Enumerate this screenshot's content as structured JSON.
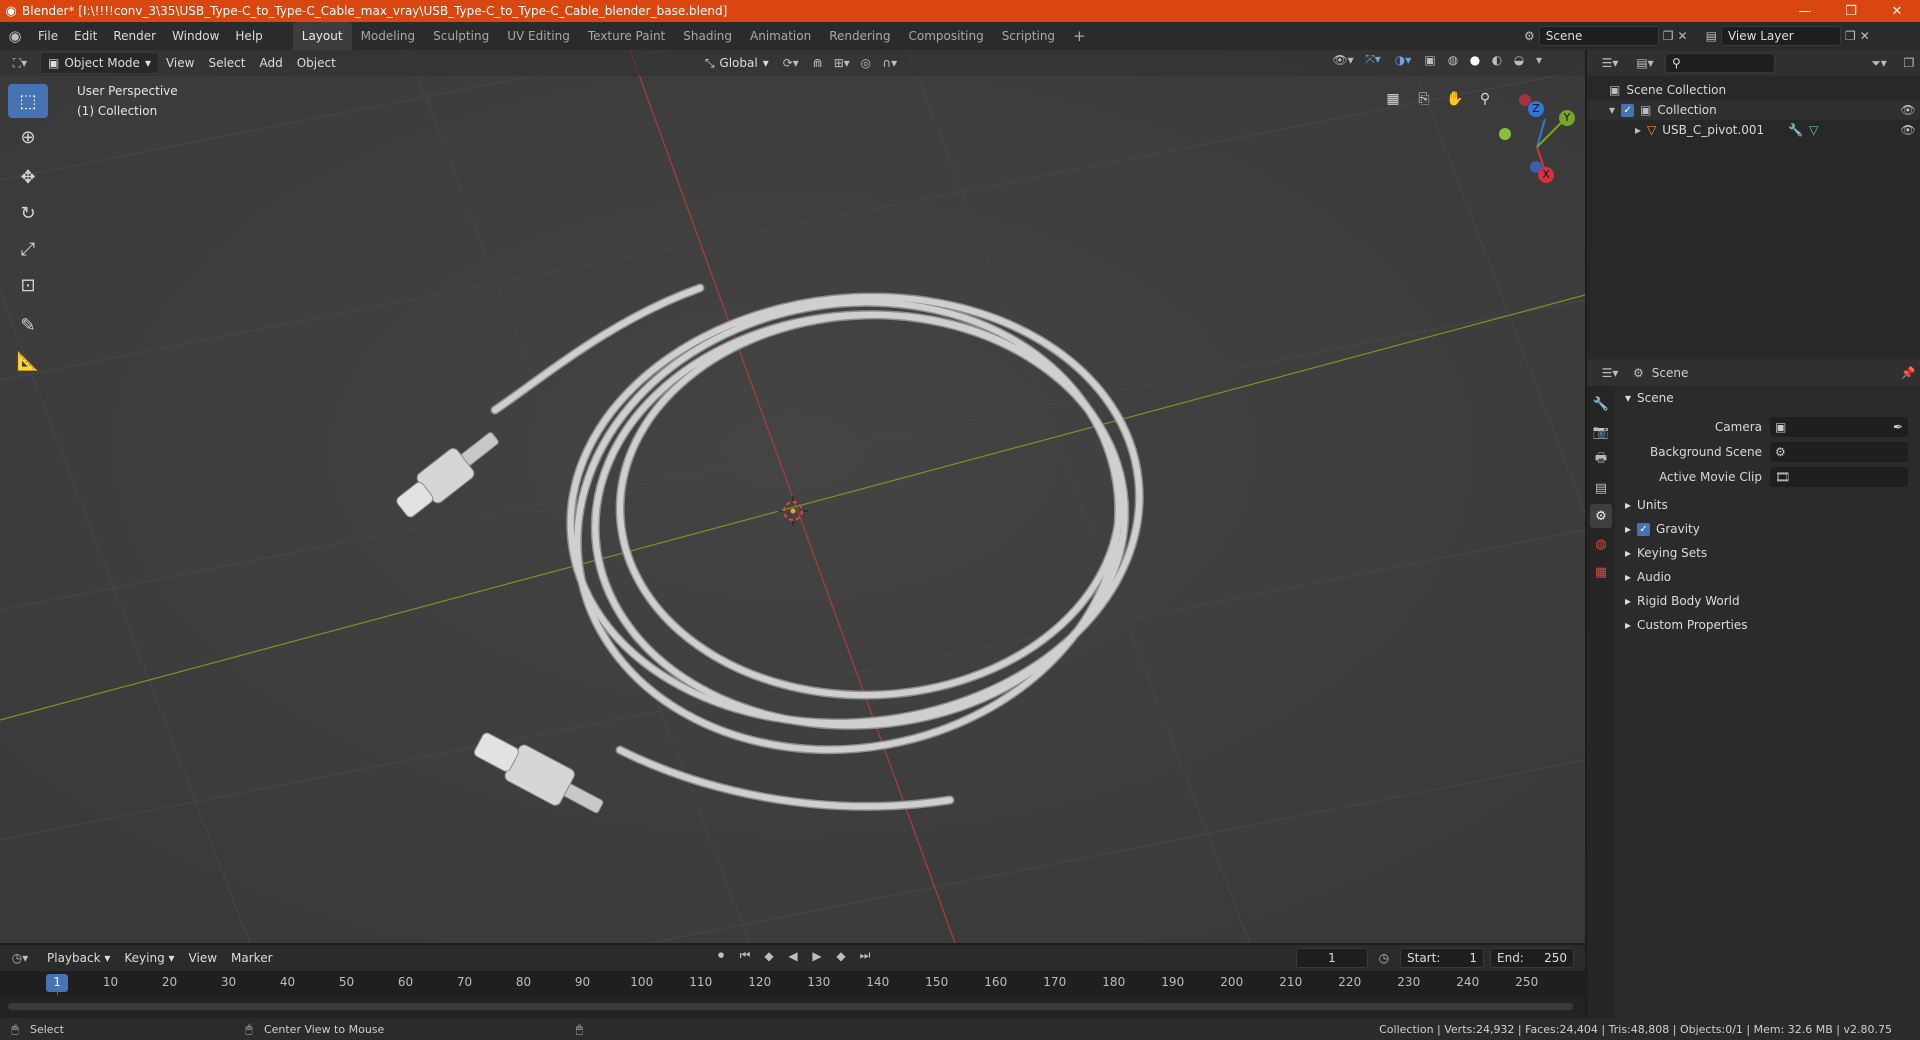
{
  "titlebar": {
    "title": "Blender* [I:\\!!!!conv_3\\35\\USB_Type-C_to_Type-C_Cable_max_vray\\USB_Type-C_to_Type-C_Cable_blender_base.blend]",
    "minimize": "—",
    "maximize": "❐",
    "close": "✕"
  },
  "menu": [
    "File",
    "Edit",
    "Render",
    "Window",
    "Help"
  ],
  "workspaces": [
    "Layout",
    "Modeling",
    "Sculpting",
    "UV Editing",
    "Texture Paint",
    "Shading",
    "Animation",
    "Rendering",
    "Compositing",
    "Scripting"
  ],
  "workspace_add": "+",
  "scene_selector": {
    "value": "Scene"
  },
  "view_layer": {
    "value": "View Layer"
  },
  "viewport_header": {
    "mode": "Object Mode",
    "menus": [
      "View",
      "Select",
      "Add",
      "Object"
    ],
    "orientation": "Global"
  },
  "viewport": {
    "perspective": "User Perspective",
    "collection": "(1) Collection",
    "gizmo_axes": {
      "x": "X",
      "y": "Y",
      "z": "Z"
    }
  },
  "outliner": {
    "search_placeholder": "",
    "items": [
      {
        "label": "Scene Collection"
      },
      {
        "label": "Collection"
      },
      {
        "label": "USB_C_pivot.001"
      }
    ]
  },
  "properties": {
    "header": "Scene",
    "section": "Scene",
    "fields": [
      {
        "label": "Camera",
        "value": ""
      },
      {
        "label": "Background Scene",
        "value": ""
      },
      {
        "label": "Active Movie Clip",
        "value": ""
      }
    ],
    "panels": [
      "Units",
      "Gravity",
      "Keying Sets",
      "Audio",
      "Rigid Body World",
      "Custom Properties"
    ],
    "gravity_enabled": true
  },
  "timeline": {
    "menus": [
      "Playback",
      "Keying",
      "View",
      "Marker"
    ],
    "current_frame": "1",
    "start_label": "Start:",
    "start_value": "1",
    "end_label": "End:",
    "end_value": "250",
    "ticks": [
      "1",
      "10",
      "20",
      "30",
      "40",
      "50",
      "60",
      "70",
      "80",
      "90",
      "100",
      "110",
      "120",
      "130",
      "140",
      "150",
      "160",
      "170",
      "180",
      "190",
      "200",
      "210",
      "220",
      "230",
      "240",
      "250"
    ]
  },
  "statusbar": {
    "select": "Select",
    "center_view": "Center View to Mouse",
    "stats": "Collection | Verts:24,932 | Faces:24,404 | Tris:48,808 | Objects:0/1 | Mem: 32.6 MB | v2.80.75"
  },
  "colors": {
    "title_bar": "#d9460f",
    "accent": "#4772b3",
    "viewport_bg": "#3d3d3d",
    "x_axis": "#b5393a",
    "y_axis": "#6e9a24"
  }
}
